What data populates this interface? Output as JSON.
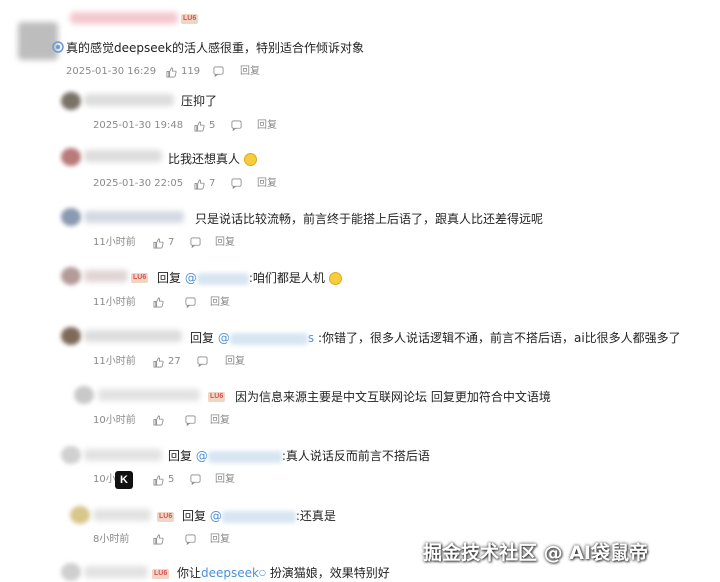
{
  "comments": [
    {
      "level": 0,
      "text": "真的感觉deepseek的活人感很重，特别适合作倾诉对象",
      "timestamp": "2025-01-30 16:29",
      "likes": "119",
      "reply_label": "回复",
      "badge": "LU6"
    },
    {
      "level": 1,
      "text": "压抑了",
      "timestamp": "2025-01-30 19:48",
      "likes": "5",
      "reply_label": "回复"
    },
    {
      "level": 1,
      "text": "比我还想真人",
      "timestamp": "2025-01-30 22:05",
      "likes": "7",
      "reply_label": "回复"
    },
    {
      "level": 1,
      "text": "只是说话比较流畅，前言终于能搭上后语了，跟真人比还差得远呢",
      "timestamp": "11小时前",
      "likes": "7",
      "reply_label": "回复"
    },
    {
      "level": 1,
      "reply_prefix": "回复",
      "at": "@",
      "text": ":咱们都是人机",
      "timestamp": "11小时前",
      "likes": "",
      "reply_label": "回复",
      "badge": "LU6"
    },
    {
      "level": 1,
      "reply_prefix": "回复",
      "at": "@",
      "mention_tail": "s",
      "text": ":你错了，很多人说话逻辑不通，前言不搭后语，ai比很多人都强多了",
      "timestamp": "11小时前",
      "likes": "27",
      "reply_label": "回复"
    },
    {
      "level": 1,
      "text": "因为信息来源主要是中文互联网论坛 回复更加符合中文语境",
      "timestamp": "10小时前",
      "likes": "",
      "reply_label": "回复",
      "badge": "LU6"
    },
    {
      "level": 1,
      "reply_prefix": "回复",
      "at": "@",
      "text": ":真人说话反而前言不搭后语",
      "timestamp": "10小",
      "likes": "5",
      "reply_label": "回复"
    },
    {
      "level": 1,
      "reply_prefix": "回复",
      "at": "@",
      "text": ":还真是",
      "timestamp": "8小时前",
      "likes": "",
      "reply_label": "回复",
      "badge": "LU6"
    },
    {
      "level": 1,
      "text_prefix": "你让",
      "mention": "deepseek",
      "text": "扮演猫娘，效果特别好",
      "badge": "LU6"
    }
  ],
  "overlay_k": "K",
  "watermark": "掘金技术社区 @ AI袋鼠帝",
  "colors": {
    "link": "#4a90d9",
    "meta": "#8a8a8a",
    "badge_bg": "#f0d4c4",
    "badge_text": "#d9534f"
  }
}
